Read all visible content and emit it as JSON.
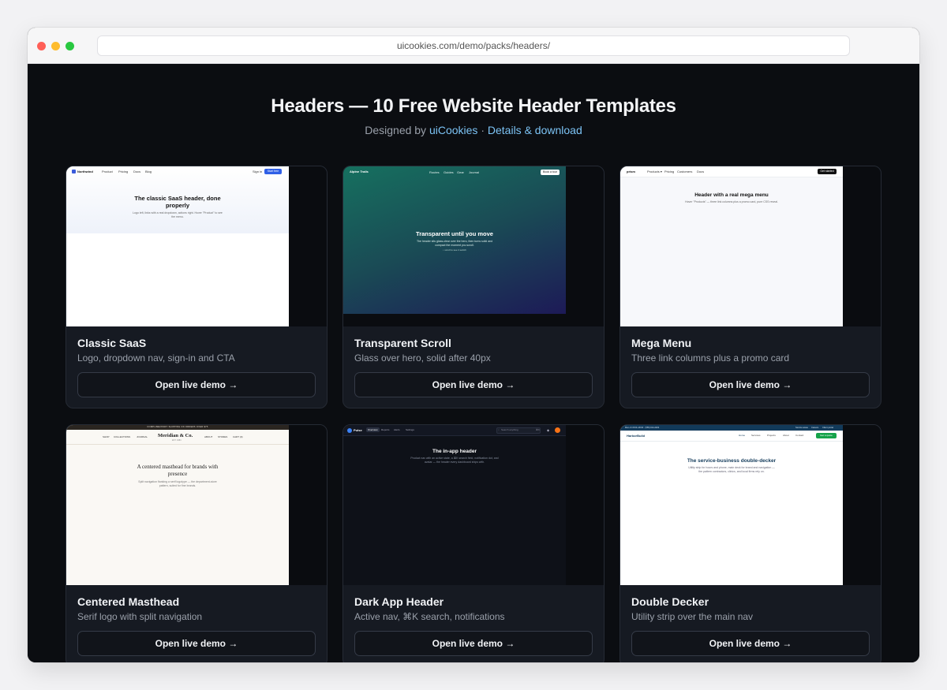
{
  "browser": {
    "url": "uicookies.com/demo/packs/headers/"
  },
  "header": {
    "title": "Headers — 10 Free Website Header Templates",
    "designed_by": "Designed by",
    "author": "uiCookies",
    "separator": "·",
    "details_link": "Details & download"
  },
  "button_label": "Open live demo →",
  "cards": [
    {
      "title": "Classic SaaS",
      "description": "Logo, dropdown nav, sign-in and CTA",
      "preview": {
        "logo": "Northwind",
        "nav": [
          "Product",
          "Pricing",
          "Docs",
          "Blog"
        ],
        "signin": "Sign in",
        "cta": "Start free",
        "headline": "The classic SaaS header, done properly",
        "body": "Logo left, links with a real dropdown, actions right. Hover \"Product\" to see the menu."
      }
    },
    {
      "title": "Transparent Scroll",
      "description": "Glass over hero, solid after 40px",
      "preview": {
        "logo": "Alpine Trails",
        "nav": [
          "Routes",
          "Guides",
          "Gear",
          "Journal"
        ],
        "cta": "Book a tour",
        "headline": "Transparent until you move",
        "body": "The header sits glass-clear over the hero, then turns solid and compact the moment you scroll.",
        "hint": "↓ scroll to see it switch"
      }
    },
    {
      "title": "Mega Menu",
      "description": "Three link columns plus a promo card",
      "preview": {
        "logo": "prism",
        "nav": [
          "Products ▾",
          "Pricing",
          "Customers",
          "Docs"
        ],
        "cta": "Get started",
        "headline": "Header with a real mega menu",
        "body": "Hover \"Products\" — three link columns plus a promo card, pure CSS reveal."
      }
    },
    {
      "title": "Centered Masthead",
      "description": "Serif logo with split navigation",
      "preview": {
        "strip": "COMPLIMENTARY SHIPPING ON ORDERS OVER $75",
        "nav_left": [
          "SHOP",
          "COLLECTIONS",
          "JOURNAL"
        ],
        "logo": "Meridian & Co.",
        "tagline": "EST. 1984",
        "nav_right": [
          "ABOUT",
          "STORES",
          "CART (0)"
        ],
        "headline": "A centered masthead for brands with presence",
        "body": "Split navigation flanking a serif logotype — the department-store pattern, suited for fine brands."
      }
    },
    {
      "title": "Dark App Header",
      "description": "Active nav, ⌘K search, notifications",
      "preview": {
        "logo": "Pulse",
        "nav": [
          "Overview",
          "Reports",
          "Alerts",
          "Settings"
        ],
        "search": "Search anything",
        "kbd": "⌘K",
        "headline": "The in-app header",
        "body": "Product nav with an active state, a ⌘K search field, notification dot, and avatar — the header every dashboard ships with."
      }
    },
    {
      "title": "Double Decker",
      "description": "Utility strip over the main nav",
      "preview": {
        "strip_left": "Mon–Fri 8:00–18:00 · (555) 014-2204",
        "strip_right": [
          "Service areas",
          "Careers",
          "Client portal"
        ],
        "logo": "HarborBuild",
        "nav": [
          "Home",
          "Services",
          "Projects",
          "About",
          "Contact"
        ],
        "cta": "Get a quote",
        "headline": "The service-business double-decker",
        "body": "Utility strip for hours and phone, main deck for brand and navigation — the pattern contractors, clinics, and local firms rely on."
      }
    }
  ]
}
